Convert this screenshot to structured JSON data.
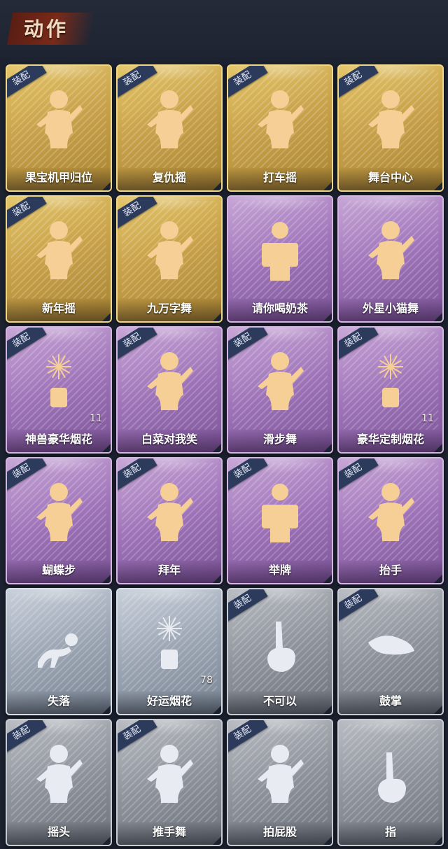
{
  "header": {
    "title": "动作"
  },
  "equip_label": "装配",
  "cards": [
    {
      "label": "果宝机甲归位",
      "rarity": "gold",
      "equipped": true,
      "count": null,
      "icon": "dancer-icon"
    },
    {
      "label": "复仇摇",
      "rarity": "gold",
      "equipped": true,
      "count": null,
      "icon": "dancer-icon"
    },
    {
      "label": "打车摇",
      "rarity": "gold",
      "equipped": true,
      "count": null,
      "icon": "dancer-icon"
    },
    {
      "label": "舞台中心",
      "rarity": "gold",
      "equipped": true,
      "count": null,
      "icon": "dancer-icon"
    },
    {
      "label": "新年摇",
      "rarity": "gold",
      "equipped": true,
      "count": null,
      "icon": "dancer-icon"
    },
    {
      "label": "九万字舞",
      "rarity": "gold",
      "equipped": true,
      "count": null,
      "icon": "dancer-icon"
    },
    {
      "label": "请你喝奶茶",
      "rarity": "purple",
      "equipped": false,
      "count": null,
      "icon": "sign-holder-icon"
    },
    {
      "label": "外星小猫舞",
      "rarity": "purple",
      "equipped": false,
      "count": null,
      "icon": "dancer-icon"
    },
    {
      "label": "神兽豪华烟花",
      "rarity": "purple",
      "equipped": true,
      "count": "11",
      "icon": "fireworks-icon"
    },
    {
      "label": "白菜对我笑",
      "rarity": "purple",
      "equipped": true,
      "count": null,
      "icon": "dancer-icon"
    },
    {
      "label": "滑步舞",
      "rarity": "purple",
      "equipped": true,
      "count": null,
      "icon": "dancer-icon"
    },
    {
      "label": "豪华定制烟花",
      "rarity": "purple",
      "equipped": true,
      "count": "11",
      "icon": "fireworks-icon"
    },
    {
      "label": "蝴蝶步",
      "rarity": "purple",
      "equipped": true,
      "count": null,
      "icon": "dancer-icon"
    },
    {
      "label": "拜年",
      "rarity": "purple",
      "equipped": true,
      "count": null,
      "icon": "dancer-icon"
    },
    {
      "label": "举牌",
      "rarity": "purple",
      "equipped": true,
      "count": null,
      "icon": "sign-holder-icon"
    },
    {
      "label": "抬手",
      "rarity": "purple",
      "equipped": true,
      "count": null,
      "icon": "dancer-icon"
    },
    {
      "label": "失落",
      "rarity": "silver",
      "equipped": false,
      "count": null,
      "icon": "crawling-figure-icon"
    },
    {
      "label": "好运烟花",
      "rarity": "silver",
      "equipped": false,
      "count": "78",
      "icon": "fireworks-icon"
    },
    {
      "label": "不可以",
      "rarity": "grey",
      "equipped": true,
      "count": null,
      "icon": "finger-wag-icon"
    },
    {
      "label": "鼓掌",
      "rarity": "grey",
      "equipped": true,
      "count": null,
      "icon": "clapping-hands-icon"
    },
    {
      "label": "摇头",
      "rarity": "grey",
      "equipped": true,
      "count": null,
      "icon": "dancer-icon"
    },
    {
      "label": "推手舞",
      "rarity": "grey",
      "equipped": true,
      "count": null,
      "icon": "dancer-icon"
    },
    {
      "label": "拍屁股",
      "rarity": "grey",
      "equipped": true,
      "count": null,
      "icon": "dancer-icon"
    },
    {
      "label": "指",
      "rarity": "grey",
      "equipped": false,
      "count": null,
      "icon": "pointing-hand-icon"
    }
  ],
  "colors": {
    "gold": "#c9a24a",
    "purple": "#9e73b8",
    "silver": "#9aa4b2",
    "grey": "#8e939b",
    "figure_gold": "#f6cf96",
    "figure_white": "#e8ecf2",
    "tag_bg": "#2c3a5c"
  }
}
